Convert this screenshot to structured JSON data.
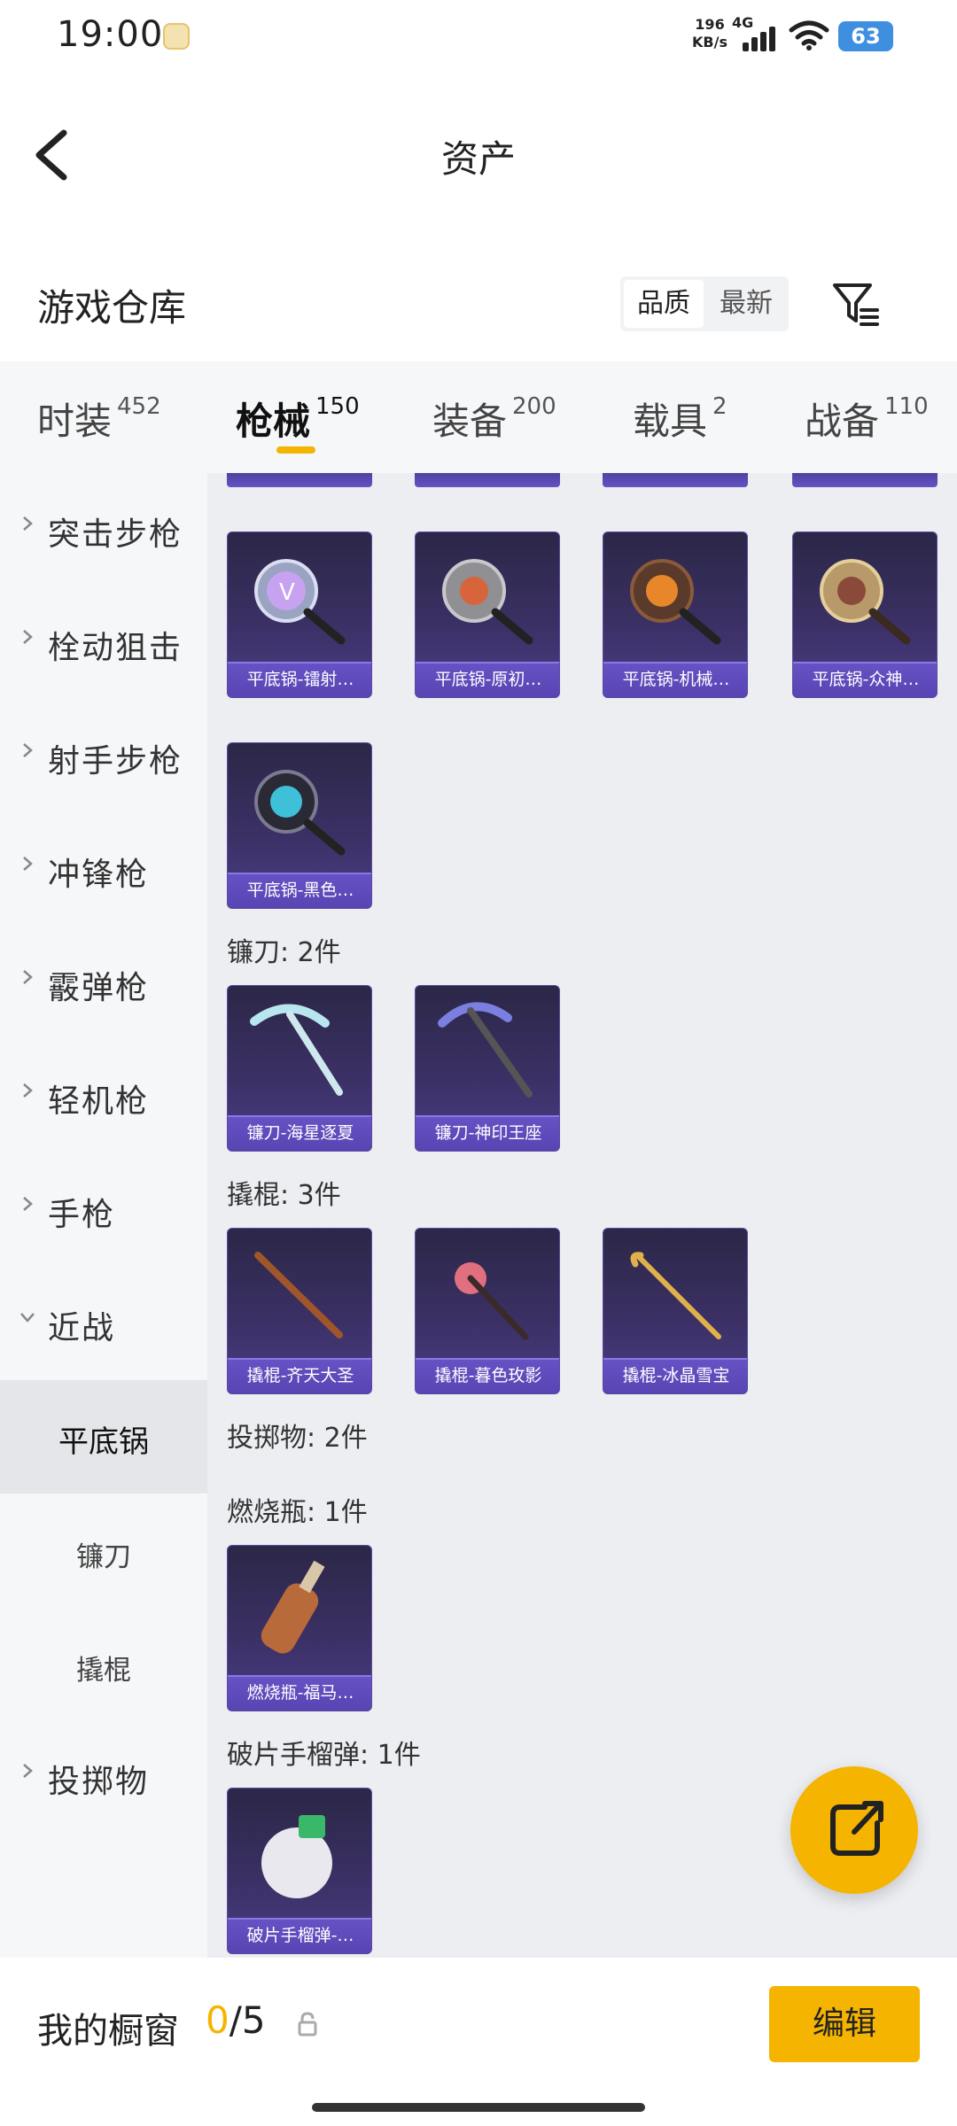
{
  "status_bar": {
    "time": "19:00",
    "net_speed": "196\nKB/s",
    "network": "4G",
    "battery": "63"
  },
  "header": {
    "title": "资产"
  },
  "section": {
    "title": "游戏仓库",
    "sort_options": [
      "品质",
      "最新"
    ],
    "active_sort": "品质"
  },
  "tabs": [
    {
      "label": "时装",
      "count": "452"
    },
    {
      "label": "枪械",
      "count": "150"
    },
    {
      "label": "装备",
      "count": "200"
    },
    {
      "label": "载具",
      "count": "2"
    },
    {
      "label": "战备",
      "count": "110"
    }
  ],
  "active_tab": "枪械",
  "sidebar": {
    "categories": [
      "突击步枪",
      "栓动狙击",
      "射手步枪",
      "冲锋枪",
      "霰弹枪",
      "轻机枪",
      "手枪",
      "近战"
    ],
    "melee_subs": [
      "平底锅",
      "镰刀",
      "撬棍"
    ],
    "selected_sub": "平底锅",
    "last_category": "投掷物"
  },
  "content": {
    "pan_items": [
      "平底锅-镭射…",
      "平底锅-原初…",
      "平底锅-机械…",
      "平底锅-众神…",
      "平底锅-黑色…"
    ],
    "sickle_header": "镰刀: 2件",
    "sickle_items": [
      "镰刀-海星逐夏",
      "镰刀-神印王座"
    ],
    "crowbar_header": "撬棍: 3件",
    "crowbar_items": [
      "撬棍-齐天大圣",
      "撬棍-暮色玫影",
      "撬棍-冰晶雪宝"
    ],
    "throwable_header": "投掷物: 2件",
    "molotov_header": "燃烧瓶: 1件",
    "molotov_items": [
      "燃烧瓶-福马…"
    ],
    "grenade_header": "破片手榴弹: 1件",
    "grenade_items": [
      "破片手榴弹-…"
    ]
  },
  "bottom_bar": {
    "window_label": "我的橱窗",
    "window_current": "0",
    "window_total": "/5",
    "edit_label": "编辑"
  },
  "colors": {
    "accent": "#f5b400",
    "card_label": "#6652c4"
  }
}
